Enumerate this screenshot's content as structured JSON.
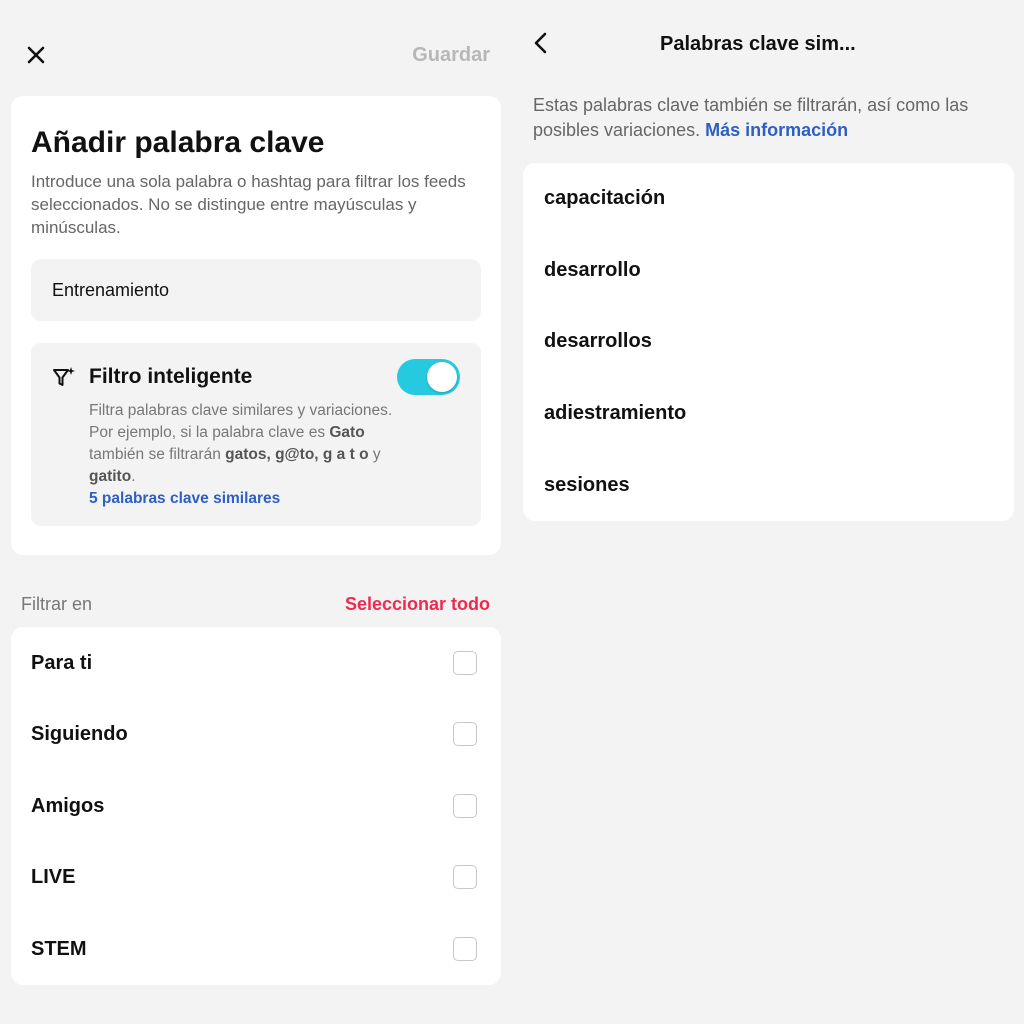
{
  "left": {
    "close_icon": "close-icon",
    "save_label": "Guardar",
    "title": "Añadir palabra clave",
    "description": "Introduce una sola palabra o hashtag para filtrar los feeds seleccionados. No se distingue entre mayúsculas y minúsculas.",
    "keyword_value": "Entrenamiento",
    "smart_filter": {
      "icon": "smart-filter-icon",
      "title": "Filtro inteligente",
      "enabled": true,
      "desc_line1": "Filtra palabras clave similares y variaciones.",
      "desc_line2_pre": " Por ejemplo, si la palabra clave es ",
      "desc_word": "Gato",
      "desc_line3_pre": " también se filtrarán ",
      "desc_variants": "gatos, g@to, g a t o",
      "desc_line3_post": " y",
      "desc_line4": " gatito",
      "desc_line4_end": ".",
      "link": "5 palabras clave similares"
    },
    "filter_in_label": "Filtrar en",
    "select_all_label": "Seleccionar todo",
    "feeds": [
      {
        "label": "Para ti",
        "checked": false
      },
      {
        "label": "Siguiendo",
        "checked": false
      },
      {
        "label": "Amigos",
        "checked": false
      },
      {
        "label": "LIVE",
        "checked": false
      },
      {
        "label": "STEM",
        "checked": false
      }
    ]
  },
  "right": {
    "back_icon": "chevron-left-icon",
    "title": "Palabras clave sim...",
    "description": "Estas palabras clave también se filtrarán, así como las posibles variaciones. ",
    "more_info": "Más información",
    "similar": [
      "capacitación",
      "desarrollo",
      "desarrollos",
      "adiestramiento",
      "sesiones"
    ]
  },
  "colors": {
    "accent_toggle": "#25c9e0",
    "link_blue": "#2d5fc4",
    "select_all_red": "#f02a4f"
  }
}
